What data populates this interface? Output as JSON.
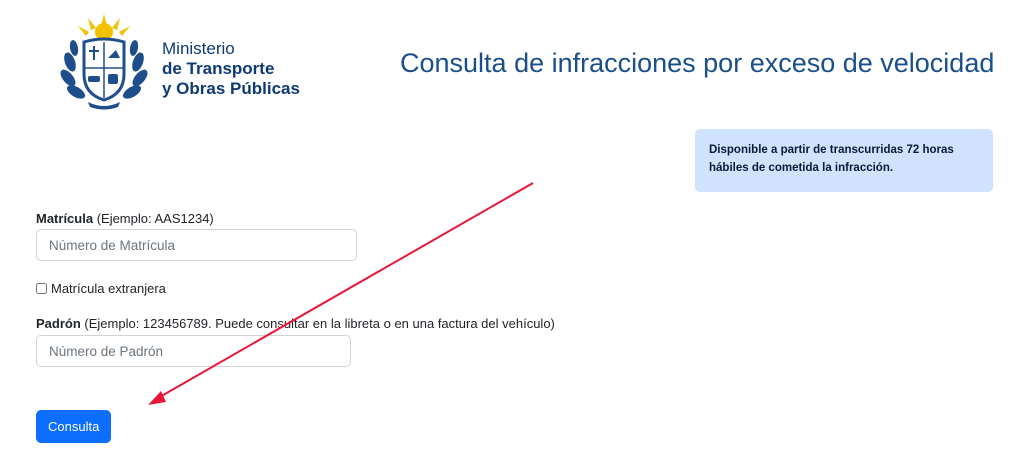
{
  "header": {
    "logo": {
      "line1": "Ministerio",
      "line2": "de Transporte",
      "line3": "y Obras Públicas",
      "icon": "coat-of-arms-icon"
    },
    "title": "Consulta de infracciones por exceso de velocidad"
  },
  "info_box": {
    "text": "Disponible a partir de transcurridas 72 horas hábiles de cometida la infracción."
  },
  "form": {
    "matricula": {
      "label": "Matrícula",
      "hint": " (Ejemplo: AAS1234)",
      "placeholder": "Número de Matrícula",
      "value": ""
    },
    "extranjera": {
      "label": "Matrícula extranjera",
      "checked": false
    },
    "padron": {
      "label": "Padrón",
      "hint": " (Ejemplo: 123456789. Puede consultar en la libreta o en una factura del vehículo)",
      "placeholder": "Número de Padrón",
      "value": ""
    },
    "submit_label": "Consulta"
  },
  "colors": {
    "brand_text": "#0d3a75",
    "title": "#1a4f8b",
    "info_bg": "#cfe2ff",
    "primary": "#0d6efd",
    "annotation_arrow": "#e8173a"
  }
}
